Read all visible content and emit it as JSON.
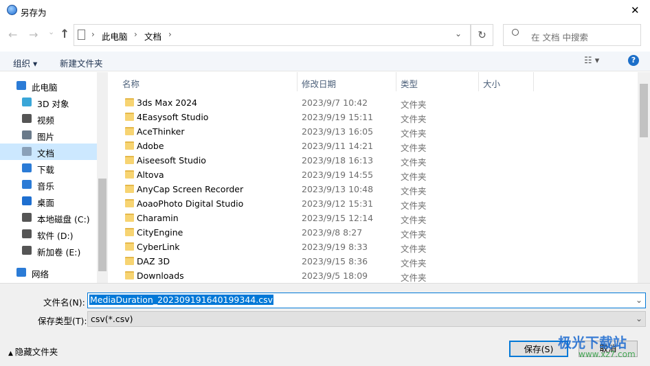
{
  "window": {
    "title": "另存为",
    "close": "✕"
  },
  "nav": {
    "back": "←",
    "forward": "→",
    "recent": "⌄",
    "up": "↑",
    "breadcrumb": [
      "此电脑",
      "文档"
    ],
    "refresh": "↻",
    "search_placeholder": "在 文档 中搜索",
    "dropdown": "⌄"
  },
  "toolbar": {
    "organize": "组织 ▾",
    "new_folder": "新建文件夹",
    "view": "☷ ▾",
    "help": "?"
  },
  "sidebar": {
    "items": [
      {
        "label": "此电脑",
        "icon": "computer-icon",
        "color": "#2b7bd6"
      },
      {
        "label": "3D 对象",
        "icon": "3d-objects-icon",
        "color": "#3aa6d8"
      },
      {
        "label": "视频",
        "icon": "video-icon",
        "color": "#555555"
      },
      {
        "label": "图片",
        "icon": "pictures-icon",
        "color": "#6a7a8a"
      },
      {
        "label": "文档",
        "icon": "documents-icon",
        "color": "#8aa0b8"
      },
      {
        "label": "下载",
        "icon": "download-icon",
        "color": "#2b7bd6"
      },
      {
        "label": "音乐",
        "icon": "music-icon",
        "color": "#2b7bd6"
      },
      {
        "label": "桌面",
        "icon": "desktop-icon",
        "color": "#1e6fd0"
      },
      {
        "label": "本地磁盘 (C:)",
        "icon": "drive-icon",
        "color": "#555555"
      },
      {
        "label": "软件 (D:)",
        "icon": "drive-icon",
        "color": "#555555"
      },
      {
        "label": "新加卷 (E:)",
        "icon": "drive-icon",
        "color": "#555555"
      },
      {
        "label": "网络",
        "icon": "network-icon",
        "color": "#2b7bd6"
      }
    ],
    "selected": "文档"
  },
  "list": {
    "columns": [
      "名称",
      "修改日期",
      "类型",
      "大小"
    ],
    "rows": [
      {
        "name": "3ds Max 2024",
        "date": "2023/9/7 10:42",
        "type": "文件夹"
      },
      {
        "name": "4Easysoft Studio",
        "date": "2023/9/19 15:11",
        "type": "文件夹"
      },
      {
        "name": "AceThinker",
        "date": "2023/9/13 16:05",
        "type": "文件夹"
      },
      {
        "name": "Adobe",
        "date": "2023/9/11 14:21",
        "type": "文件夹"
      },
      {
        "name": "Aiseesoft Studio",
        "date": "2023/9/18 16:13",
        "type": "文件夹"
      },
      {
        "name": "Altova",
        "date": "2023/9/19 14:55",
        "type": "文件夹"
      },
      {
        "name": "AnyCap Screen Recorder",
        "date": "2023/9/13 10:48",
        "type": "文件夹"
      },
      {
        "name": "AoaoPhoto Digital Studio",
        "date": "2023/9/12 15:31",
        "type": "文件夹"
      },
      {
        "name": "Charamin",
        "date": "2023/9/15 12:14",
        "type": "文件夹"
      },
      {
        "name": "CityEngine",
        "date": "2023/9/8 8:27",
        "type": "文件夹"
      },
      {
        "name": "CyberLink",
        "date": "2023/9/19 8:33",
        "type": "文件夹"
      },
      {
        "name": "DAZ 3D",
        "date": "2023/9/15 8:36",
        "type": "文件夹"
      },
      {
        "name": "Downloads",
        "date": "2023/9/5 18:09",
        "type": "文件夹"
      }
    ]
  },
  "form": {
    "filename_label": "文件名(N):",
    "filename": "MediaDuration_202309191640199344.csv",
    "type_label": "保存类型(T):",
    "type": "csv(*.csv)",
    "hide_folders": "隐藏文件夹",
    "save": "保存(S)",
    "cancel": "取消"
  },
  "watermark": {
    "text": "极光下载站",
    "url": "www.xz7.com"
  }
}
